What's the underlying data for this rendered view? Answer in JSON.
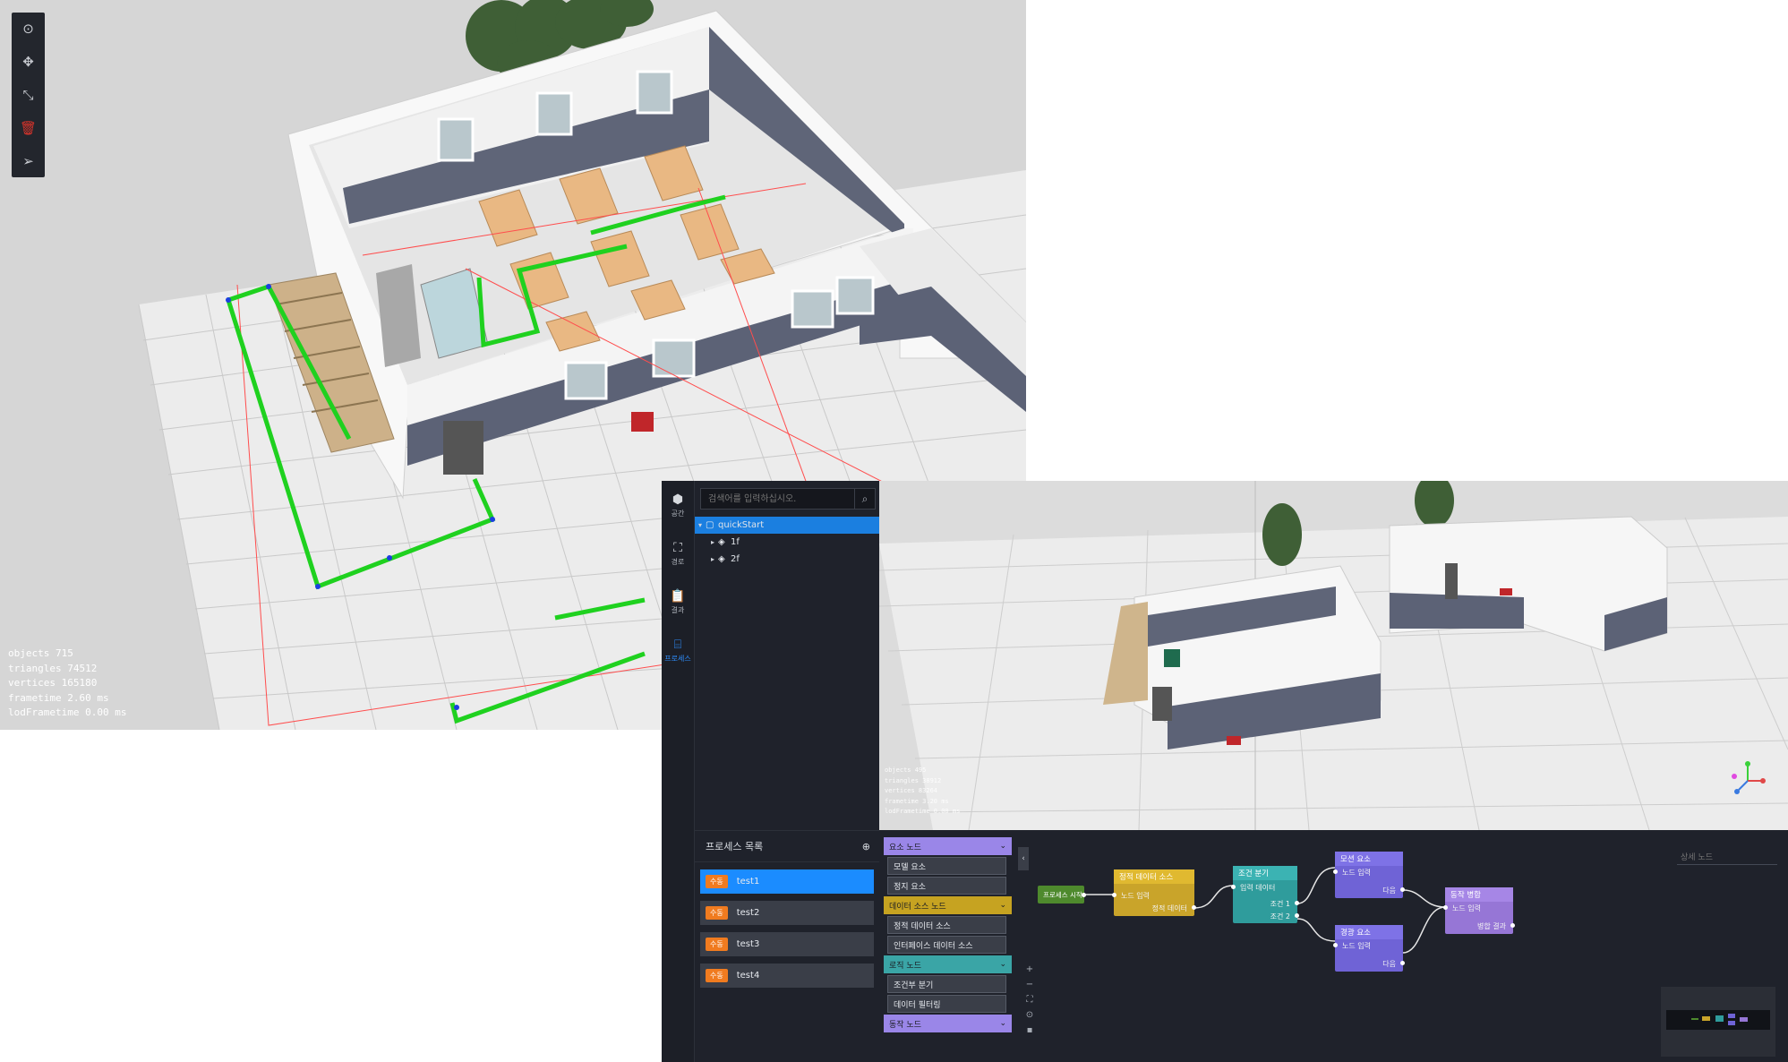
{
  "scene1": {
    "toolbar": {
      "tools": [
        {
          "name": "select-tool",
          "icon": "target-icon",
          "glyph": "⊙"
        },
        {
          "name": "move-tool",
          "icon": "move-icon",
          "glyph": "✥"
        },
        {
          "name": "scale-tool",
          "icon": "scale-icon",
          "glyph": "⤡"
        },
        {
          "name": "delete-tool",
          "icon": "trash-icon",
          "glyph": "🗑"
        },
        {
          "name": "send-tool",
          "icon": "send-icon",
          "glyph": "➢"
        }
      ],
      "delete_color": "#d9342b"
    },
    "stats": {
      "objects": "objects  715",
      "triangles": "triangles  74512",
      "vertices": "vertices  165180",
      "frametime": "frametime  2.60 ms",
      "lodframetime": "lodFrametime  0.00 ms"
    }
  },
  "scene2": {
    "sidebar": {
      "items": [
        {
          "icon": "cube-icon",
          "label": "공간"
        },
        {
          "icon": "network-icon",
          "label": "경로"
        },
        {
          "icon": "clipboard-icon",
          "label": "결과"
        },
        {
          "icon": "process-icon",
          "label": "프로세스"
        }
      ]
    },
    "search": {
      "placeholder": "검색어를 입력하십시오.",
      "icon": "search-icon"
    },
    "tree": {
      "root": "quickStart",
      "children": [
        "1f",
        "2f"
      ]
    },
    "process": {
      "title": "프로세스 목록",
      "items": [
        {
          "badge": "수동",
          "label": "test1"
        },
        {
          "badge": "수동",
          "label": "test2"
        },
        {
          "badge": "수동",
          "label": "test3"
        },
        {
          "badge": "수동",
          "label": "test4"
        }
      ]
    },
    "stats": {
      "objects": "objects  495",
      "triangles": "triangles  38912",
      "vertices": "vertices  83264",
      "frametime": "frametime  3.20 ms",
      "lodframetime": "lodFrametime  0.00 ms"
    },
    "palette": {
      "groups": [
        {
          "label": "요소 노드",
          "color": "#9a86e8",
          "items": [
            "모델 요소",
            "정지 요소"
          ]
        },
        {
          "label": "데이터 소스 노드",
          "color": "#c6a321",
          "items": [
            "정적 데이터 소스",
            "인터페이스 데이터 소스"
          ]
        },
        {
          "label": "로직 노드",
          "color": "#3aa5a6",
          "items": [
            "조건부 분기",
            "데이터 필터링"
          ]
        },
        {
          "label": "동작 노드",
          "color": "#9a86e8",
          "items": []
        }
      ]
    },
    "detail_placeholder": "상세 노드",
    "graph": {
      "nodes": {
        "start": {
          "label": "프로세스 시작",
          "color": "#4e8a2d"
        },
        "datasource": {
          "label": "정적 데이터 소스",
          "in": "노드 입력",
          "out": "정적 데이터",
          "color": "#c9a42a"
        },
        "branch": {
          "label": "조건 분기",
          "in": "입력 데이터",
          "out1": "조건 1",
          "out2": "조건 2",
          "color": "#2f9c9c"
        },
        "action1": {
          "label": "모션 요소",
          "in": "노드 입력",
          "out": "다음",
          "color": "#6f63d6"
        },
        "action2": {
          "label": "경광 요소",
          "in": "노드 입력",
          "out": "다음",
          "color": "#6f63d6"
        },
        "end": {
          "label": "동작 병합",
          "in": "노드 입력",
          "out": "병합 결과",
          "color": "#9676d6"
        }
      }
    }
  }
}
